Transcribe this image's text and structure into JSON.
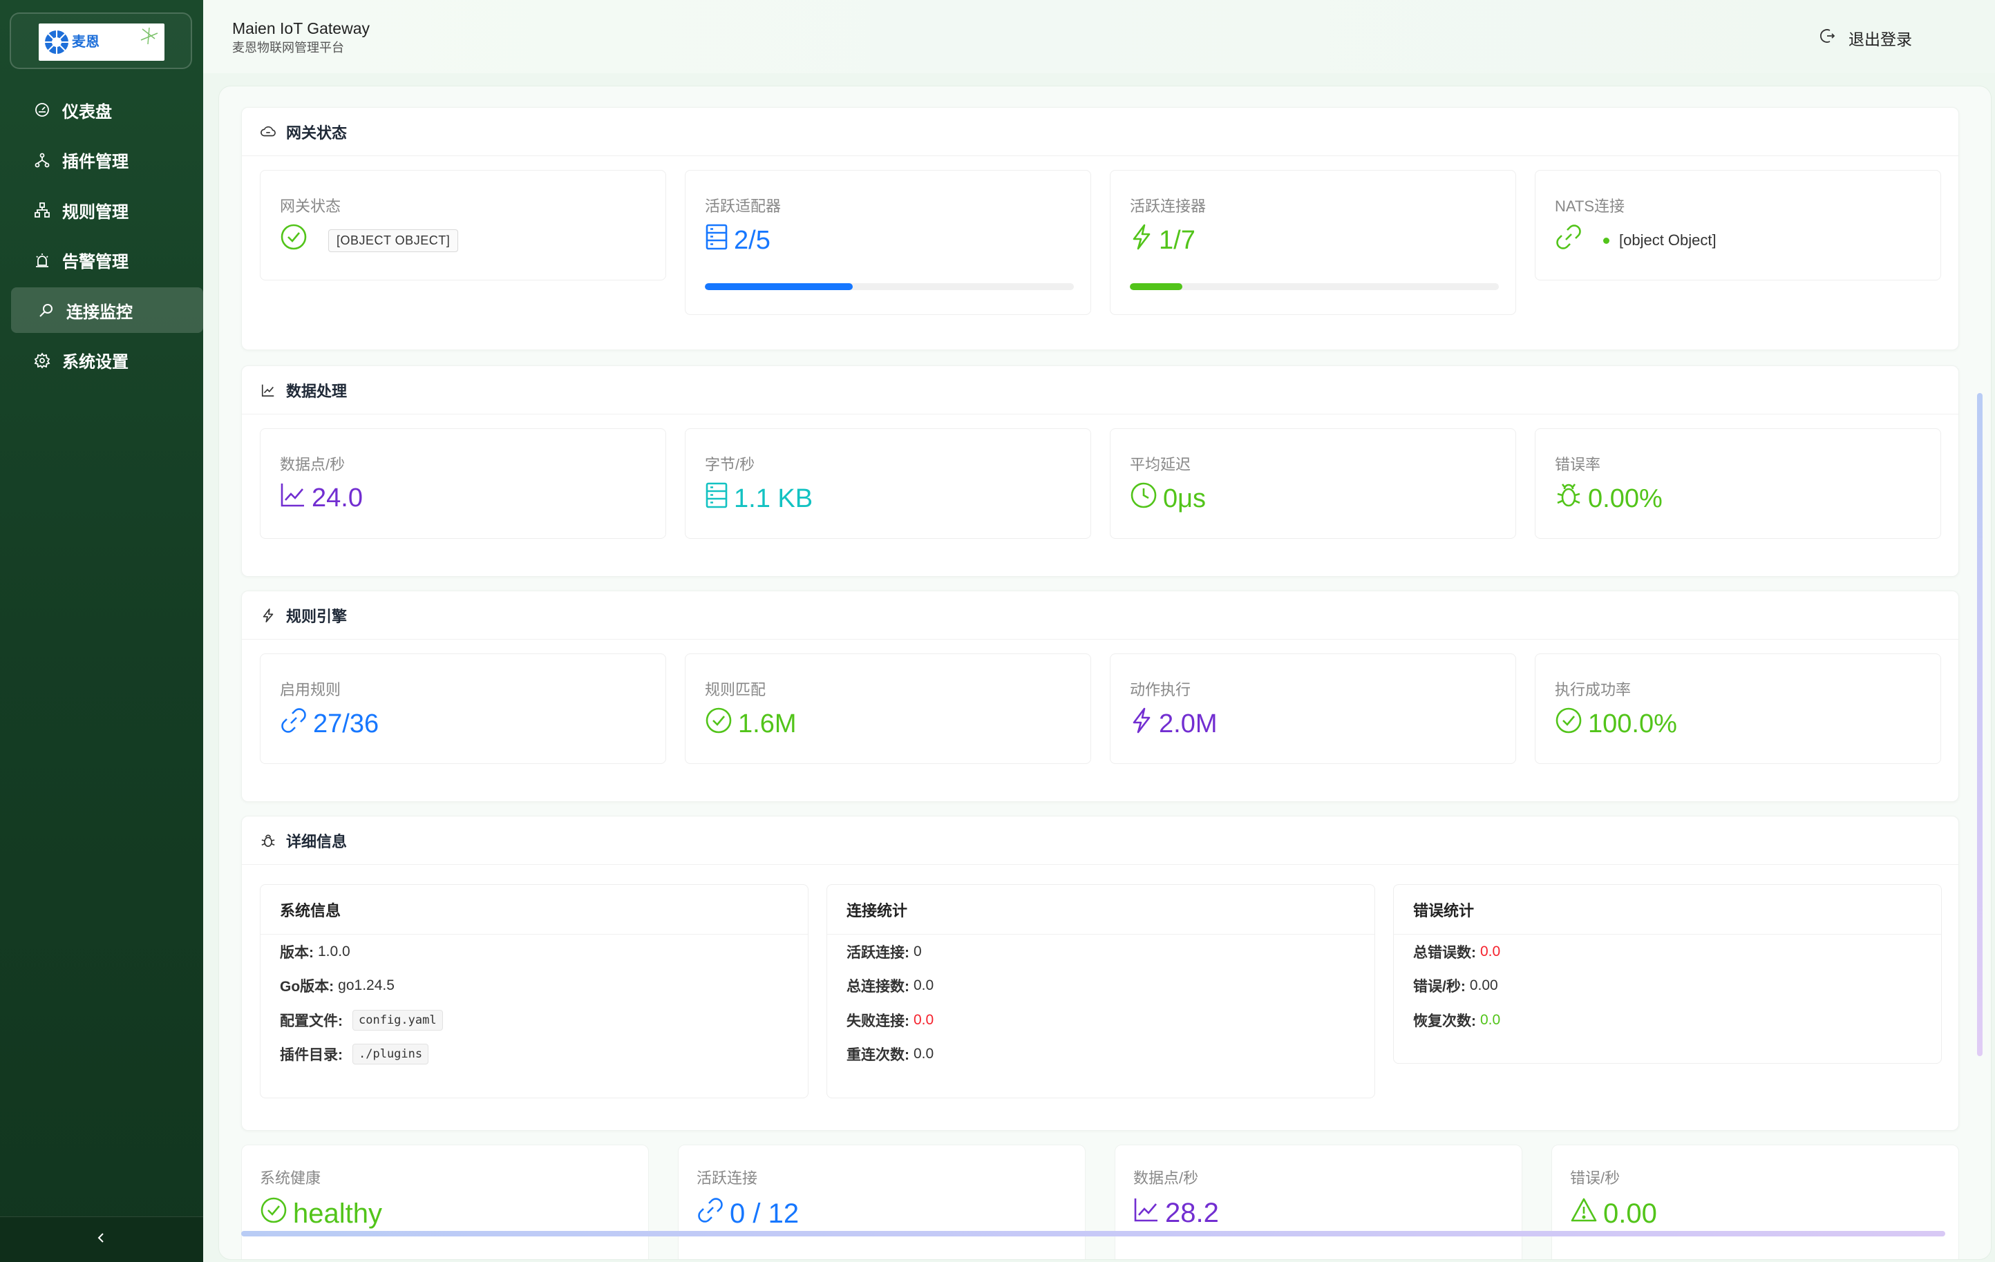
{
  "sidebar": {
    "logo_text": "麦恩",
    "items": [
      {
        "label": "仪表盘",
        "icon": "dashboard-icon"
      },
      {
        "label": "插件管理",
        "icon": "apartment-icon"
      },
      {
        "label": "规则管理",
        "icon": "cluster-icon"
      },
      {
        "label": "告警管理",
        "icon": "alert-icon"
      },
      {
        "label": "连接监控",
        "icon": "monitor-search-icon",
        "active": true
      },
      {
        "label": "系统设置",
        "icon": "setting-icon"
      }
    ],
    "collapse_icon": "chevron-left-icon"
  },
  "header": {
    "title": "Maien IoT Gateway",
    "subtitle": "麦恩物联网管理平台",
    "logout_label": "退出登录"
  },
  "gateway": {
    "title": "网关状态",
    "stats": [
      {
        "label": "网关状态",
        "tag": "[OBJECT OBJECT]",
        "color": "#52c41a"
      },
      {
        "label": "活跃适配器",
        "value": "2/5",
        "progress": 0.4,
        "color": "#1677ff"
      },
      {
        "label": "活跃连接器",
        "value": "1/7",
        "progress": 0.142,
        "color": "#52c41a"
      },
      {
        "label": "NATS连接",
        "value": "[object Object]",
        "color": "#52c41a"
      }
    ]
  },
  "data_processing": {
    "title": "数据处理",
    "stats": [
      {
        "label": "数据点/秒",
        "value": "24.0",
        "color": "#722ed1"
      },
      {
        "label": "字节/秒",
        "value": "1.1 KB",
        "color": "#13c2c2"
      },
      {
        "label": "平均延迟",
        "value": "0μs",
        "color": "#52c41a"
      },
      {
        "label": "错误率",
        "value": "0.00%",
        "color": "#52c41a"
      }
    ]
  },
  "rule_engine": {
    "title": "规则引擎",
    "stats": [
      {
        "label": "启用规则",
        "value": "27/36",
        "color": "#1677ff"
      },
      {
        "label": "规则匹配",
        "value": "1.6M",
        "color": "#52c41a"
      },
      {
        "label": "动作执行",
        "value": "2.0M",
        "color": "#722ed1"
      },
      {
        "label": "执行成功率",
        "value": "100.0%",
        "color": "#52c41a"
      }
    ]
  },
  "details": {
    "title": "详细信息",
    "system": {
      "title": "系统信息",
      "version_label": "版本:",
      "version": "1.0.0",
      "go_label": "Go版本:",
      "go": "go1.24.5",
      "config_label": "配置文件:",
      "config": "config.yaml",
      "plugins_label": "插件目录:",
      "plugins": "./plugins"
    },
    "connection": {
      "title": "连接统计",
      "active_label": "活跃连接:",
      "active": "0",
      "total_label": "总连接数:",
      "total": "0.0",
      "failed_label": "失败连接:",
      "failed": "0.0",
      "reconnect_label": "重连次数:",
      "reconnect": "0.0"
    },
    "errors": {
      "title": "错误统计",
      "total_label": "总错误数:",
      "total": "0.0",
      "per_sec_label": "错误/秒:",
      "per_sec": "0.00",
      "recovery_label": "恢复次数:",
      "recovery": "0.0"
    }
  },
  "bottom": [
    {
      "label": "系统健康",
      "value": "healthy",
      "color": "#52c41a"
    },
    {
      "label": "活跃连接",
      "value": "0 / 12",
      "color": "#1677ff"
    },
    {
      "label": "数据点/秒",
      "value": "28.2",
      "color": "#722ed1"
    },
    {
      "label": "错误/秒",
      "value": "0.00",
      "color": "#52c41a"
    }
  ]
}
